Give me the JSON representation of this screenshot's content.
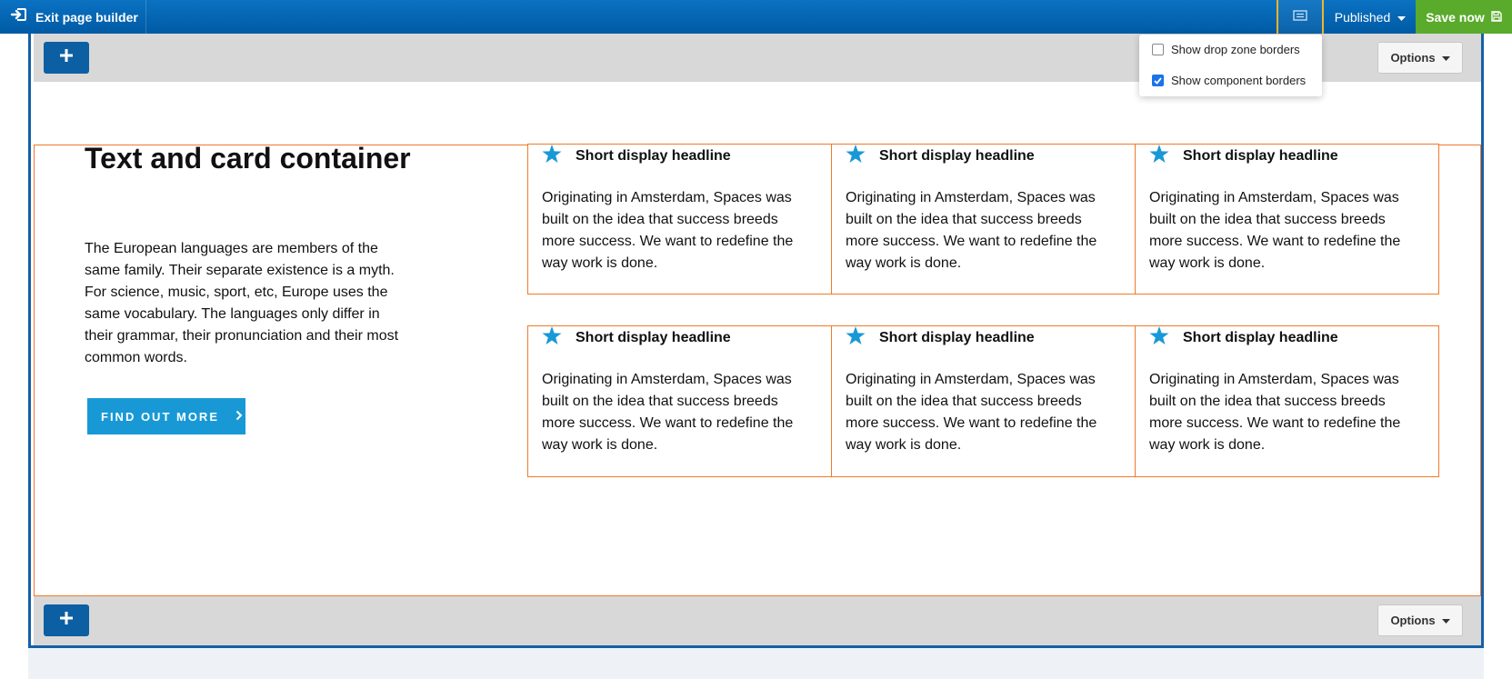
{
  "toolbar": {
    "exit_label": "Exit page builder",
    "status_label": "Published",
    "save_label": "Save now"
  },
  "popover": {
    "drop_zone_label": "Show drop zone borders",
    "drop_zone_checked": false,
    "component_label": "Show component borders",
    "component_checked": true
  },
  "dropzones": {
    "options_label": "Options"
  },
  "container": {
    "title": "Text and card container",
    "body": "The European languages are members of the same family. Their separate existence is a myth. For science, music, sport, etc, Europe uses the same vocabulary. The languages only differ in their grammar, their pronunciation and their most common words.",
    "cta_label": "FIND OUT MORE"
  },
  "cards": [
    {
      "title": "Short display headline",
      "text": "Originating in Amsterdam, Spaces was built on the idea that success breeds more success. We want to redefine the way work is done."
    },
    {
      "title": "Short display headline",
      "text": "Originating in Amsterdam, Spaces was built on the idea that success breeds more success. We want to redefine the way work is done."
    },
    {
      "title": "Short display headline",
      "text": "Originating in Amsterdam, Spaces was built on the idea that success breeds more success. We want to redefine the way work is done."
    },
    {
      "title": "Short display headline",
      "text": "Originating in Amsterdam, Spaces was built on the idea that success breeds more success. We want to redefine the way work is done."
    },
    {
      "title": "Short display headline",
      "text": "Originating in Amsterdam, Spaces was built on the idea that success breeds more success. We want to redefine the way work is done."
    },
    {
      "title": "Short display headline",
      "text": "Originating in Amsterdam, Spaces was built on the idea that success breeds more success. We want to redefine the way work is done."
    }
  ],
  "colors": {
    "toolbar_blue": "#005aa4",
    "save_green": "#5aaa2c",
    "accent_blue": "#1899d6",
    "component_border": "#f07a2a",
    "highlight_yellow": "#f0b429"
  },
  "icons": {
    "exit": "exit-icon",
    "view_toggle": "layout-icon",
    "save": "floppy-disk-icon",
    "add": "plus-icon",
    "card": "star-icon",
    "cta": "chevron-right-icon"
  }
}
